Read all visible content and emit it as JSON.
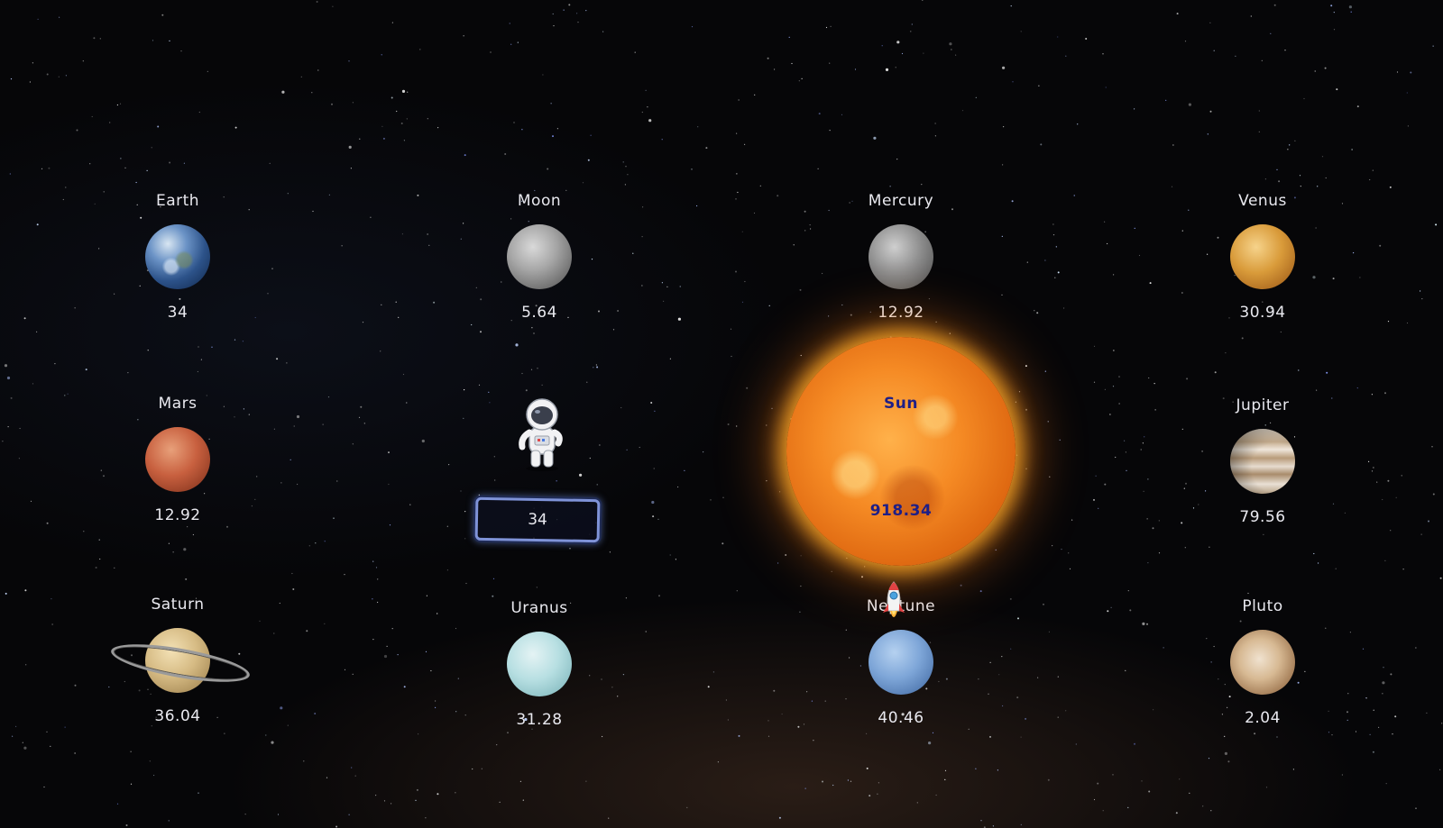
{
  "planets": [
    {
      "key": "earth",
      "name": "Earth",
      "value": "34"
    },
    {
      "key": "moon",
      "name": "Moon",
      "value": "5.64"
    },
    {
      "key": "mercury",
      "name": "Mercury",
      "value": "12.92"
    },
    {
      "key": "venus",
      "name": "Venus",
      "value": "30.94"
    },
    {
      "key": "mars",
      "name": "Mars",
      "value": "12.92"
    },
    {
      "key": "jupiter",
      "name": "Jupiter",
      "value": "79.56"
    },
    {
      "key": "saturn",
      "name": "Saturn",
      "value": "36.04"
    },
    {
      "key": "uranus",
      "name": "Uranus",
      "value": "31.28"
    },
    {
      "key": "neptune",
      "name": "Neptune",
      "value": "40.46"
    },
    {
      "key": "pluto",
      "name": "Pluto",
      "value": "2.04"
    }
  ],
  "sun": {
    "name": "Sun",
    "value": "918.34"
  },
  "weight_input": {
    "value": "34"
  },
  "icons": {
    "astronaut": "astronaut-icon",
    "rocket": "rocket-icon"
  },
  "colors": {
    "background": "#060608",
    "sun_text": "#1f1f86",
    "input_border": "#7f93d8"
  }
}
